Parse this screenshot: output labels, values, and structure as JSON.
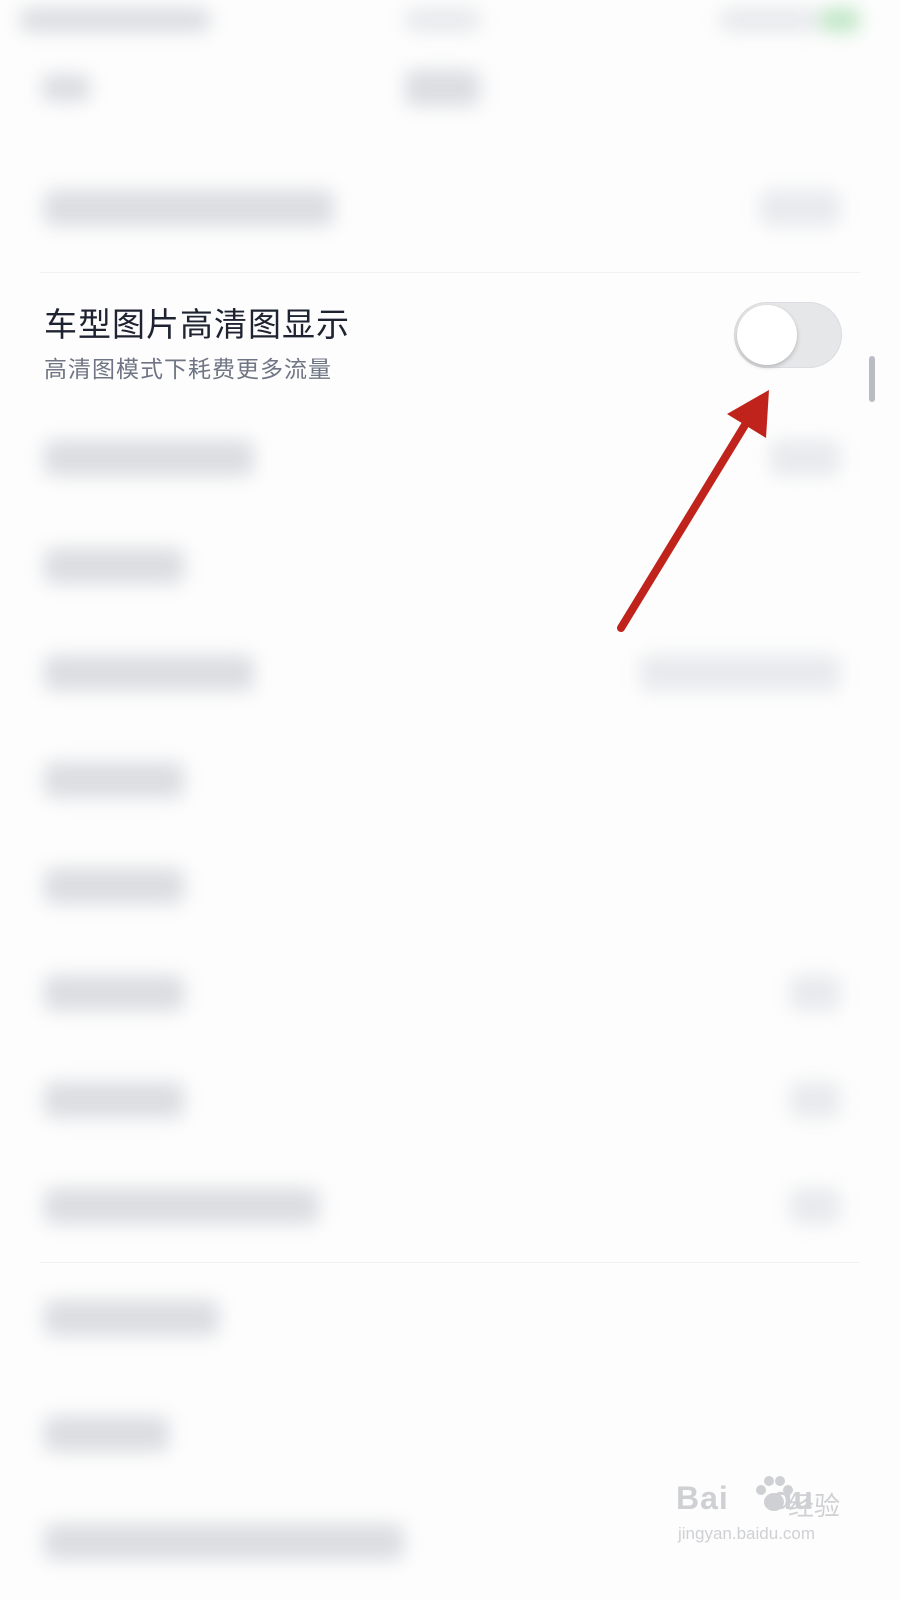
{
  "setting": {
    "title": "车型图片高清图显示",
    "subtitle": "高清图模式下耗费更多流量",
    "toggle_on": false
  },
  "colors": {
    "title": "#1d2330",
    "subtitle": "#6f7584",
    "toggle_track": "#e6e7e9",
    "toggle_knob": "#ffffff",
    "arrow": "#c0231b"
  },
  "annotation": {
    "icon": "red-arrow-icon"
  },
  "watermark": {
    "brand": "Bai",
    "brand_suffix": "du",
    "brand_cn": "经验",
    "url": "jingyan.baidu.com"
  }
}
